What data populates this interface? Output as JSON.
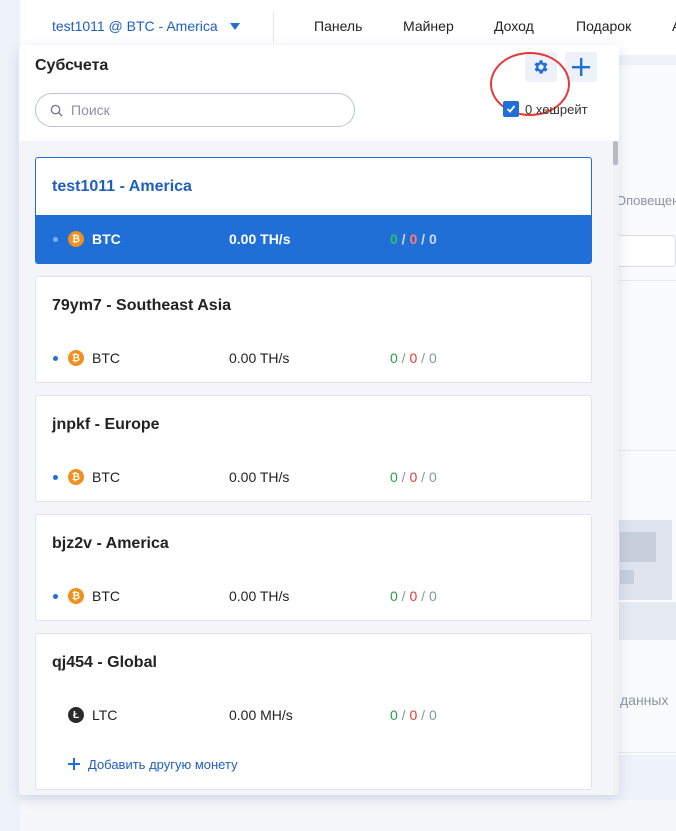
{
  "topbar": {
    "account": "test1011 @ BTC - America",
    "nav": [
      "Панель",
      "Майнер",
      "Доход",
      "Подарок",
      "А"
    ]
  },
  "background": {
    "text1": "Оповещения",
    "text2": "данных"
  },
  "panel": {
    "title": "Субсчета",
    "search_placeholder": "Поиск",
    "hashrate_toggle": "0 хешрейт"
  },
  "subaccounts": [
    {
      "name": "test1011 - America",
      "selected": true,
      "coins": [
        {
          "coin": "BTC",
          "icon": "bitcoin-icon",
          "hashrate": "0.00 TH/s",
          "active": "0",
          "inactive": "0",
          "dead": "0"
        }
      ]
    },
    {
      "name": "79ym7 - Southeast Asia",
      "selected": false,
      "coins": [
        {
          "coin": "BTC",
          "icon": "bitcoin-icon",
          "hashrate": "0.00 TH/s",
          "active": "0",
          "inactive": "0",
          "dead": "0"
        }
      ]
    },
    {
      "name": "jnpkf - Europe",
      "selected": false,
      "coins": [
        {
          "coin": "BTC",
          "icon": "bitcoin-icon",
          "hashrate": "0.00 TH/s",
          "active": "0",
          "inactive": "0",
          "dead": "0"
        }
      ]
    },
    {
      "name": "bjz2v - America",
      "selected": false,
      "coins": [
        {
          "coin": "BTC",
          "icon": "bitcoin-icon",
          "hashrate": "0.00 TH/s",
          "active": "0",
          "inactive": "0",
          "dead": "0"
        }
      ]
    },
    {
      "name": "qj454 - Global",
      "selected": false,
      "coins": [
        {
          "coin": "LTC",
          "icon": "litecoin-icon",
          "hashrate": "0.00 MH/s",
          "active": "0",
          "inactive": "0",
          "dead": "0"
        }
      ],
      "add_coin_label": "Добавить другую монету"
    }
  ],
  "colors": {
    "accent": "#1f6fd6",
    "active": "#2a9d4b",
    "inactive": "#e53935",
    "highlight_circle": "#e53935"
  },
  "separator": "/"
}
